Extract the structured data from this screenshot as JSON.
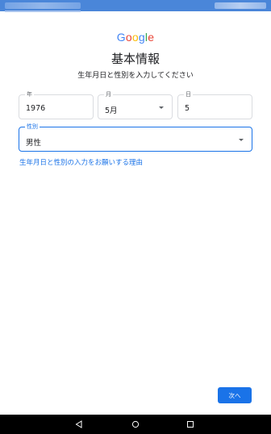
{
  "header": {
    "logo_letters": [
      {
        "ch": "G",
        "color": "#4285F4"
      },
      {
        "ch": "o",
        "color": "#EA4335"
      },
      {
        "ch": "o",
        "color": "#FBBC05"
      },
      {
        "ch": "g",
        "color": "#4285F4"
      },
      {
        "ch": "l",
        "color": "#34A853"
      },
      {
        "ch": "e",
        "color": "#EA4335"
      }
    ],
    "title": "基本情報",
    "subtitle": "生年月日と性別を入力してください"
  },
  "form": {
    "year": {
      "label": "年",
      "value": "1976"
    },
    "month": {
      "label": "月",
      "value": "5月"
    },
    "day": {
      "label": "日",
      "value": "5"
    },
    "gender": {
      "label": "性別",
      "value": "男性"
    },
    "reason_link": "生年月日と性別の入力をお願いする理由"
  },
  "footer": {
    "next_label": "次へ"
  },
  "colors": {
    "accent": "#1a73e8",
    "status_bar": "#4a86d9",
    "nav_bar": "#000000"
  },
  "nav": {
    "icons": [
      "back-triangle-icon",
      "home-circle-icon",
      "recents-square-icon"
    ]
  }
}
